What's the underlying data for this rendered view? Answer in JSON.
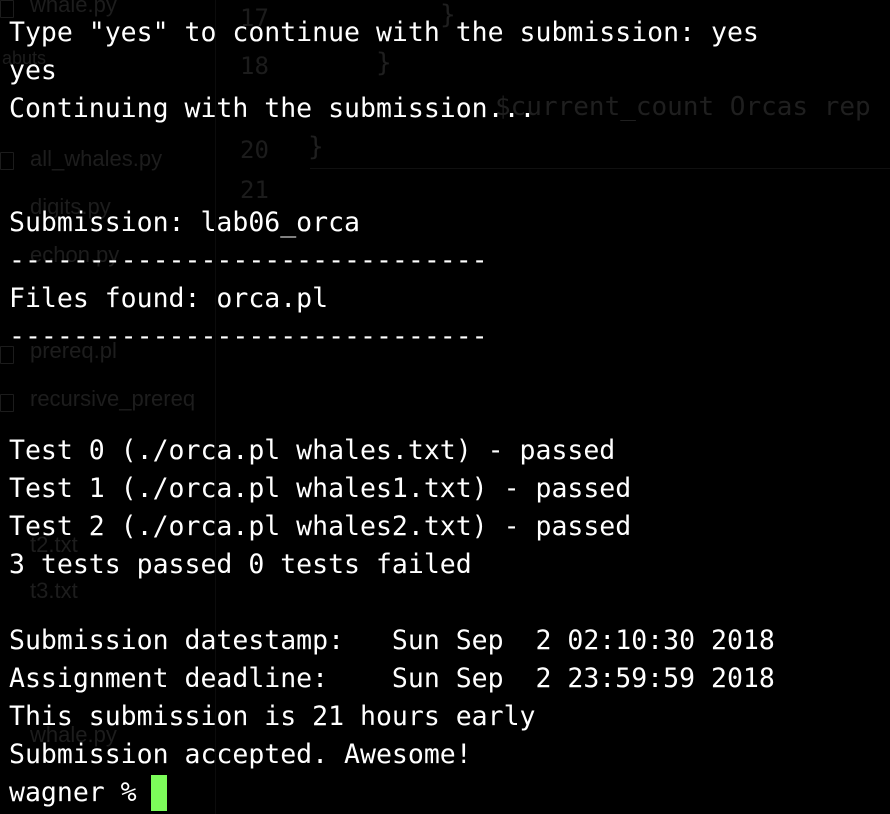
{
  "terminal": {
    "lines": [
      "Type \"yes\" to continue with the submission: yes",
      "yes",
      "Continuing with the submission...",
      "",
      "",
      "Submission: lab06_orca",
      "------------------------------",
      "Files found: orca.pl",
      "------------------------------",
      "",
      "",
      "Test 0 (./orca.pl whales.txt) - passed",
      "Test 1 (./orca.pl whales1.txt) - passed",
      "Test 2 (./orca.pl whales2.txt) - passed",
      "3 tests passed 0 tests failed",
      "",
      "Submission datestamp:   Sun Sep  2 02:10:30 2018",
      "Assignment deadline:    Sun Sep  2 23:59:59 2018",
      "This submission is 21 hours early",
      "Submission accepted. Awesome!"
    ],
    "prompt": "wagner %",
    "cursor_color": "#7cfc5a"
  },
  "ghost": {
    "sidebar_items": [
      "whale.py",
      "abuts",
      "all_whales.py",
      "digits.py",
      "echon.py",
      "prereq.pl",
      "recursive_prereq",
      "t2.txt",
      "t3.txt",
      "whale.py"
    ],
    "gutter_numbers": [
      "17",
      "18",
      "20",
      "21"
    ],
    "code_lines": [
      "}",
      "}",
      "$current_count Orcas rep",
      "}"
    ]
  }
}
